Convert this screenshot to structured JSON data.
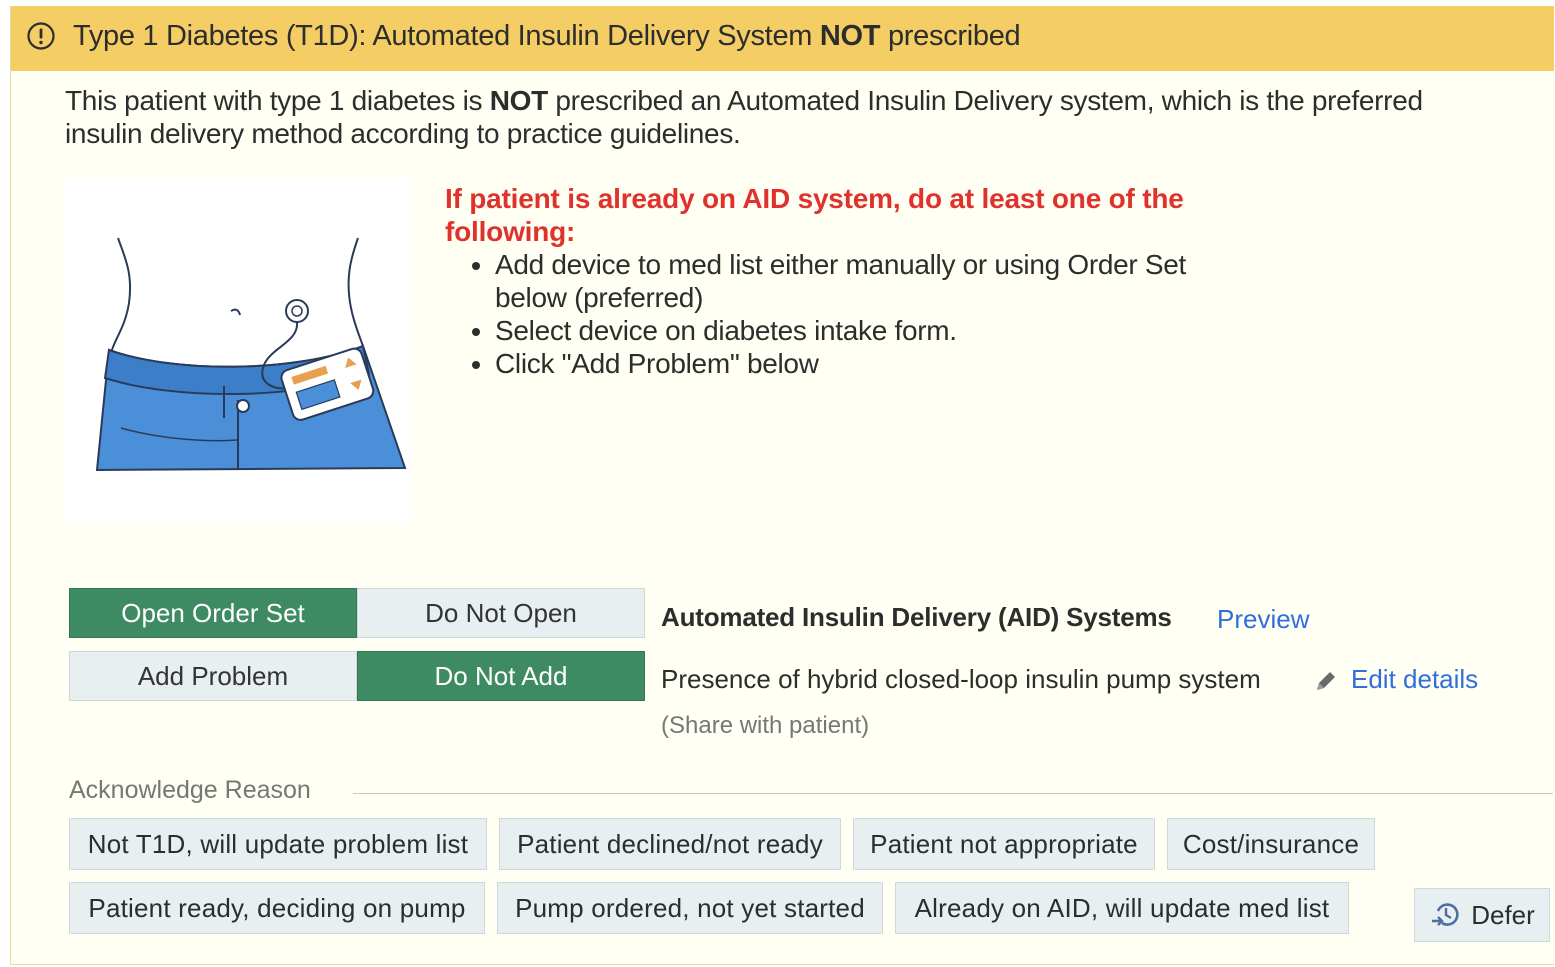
{
  "header": {
    "title_pre": "Type 1 Diabetes (T1D): Automated Insulin Delivery System ",
    "title_bold": "NOT",
    "title_post": " prescribed"
  },
  "description": {
    "pre": "This patient with type 1 diabetes is ",
    "bold": "NOT",
    "post": " prescribed an Automated Insulin Delivery system, which is the preferred insulin delivery method according to practice guidelines."
  },
  "instructions": {
    "heading": "If patient is already on AID system, do at least one of the following:",
    "items": [
      "Add device to med list either manually or using Order Set below (preferred)",
      "Select device on diabetes intake form.",
      "Click \"Add Problem\" below"
    ]
  },
  "order_set": {
    "open_label": "Open Order Set",
    "do_not_open_label": "Do Not Open",
    "title": "Automated Insulin Delivery (AID) Systems",
    "preview_label": "Preview"
  },
  "problem": {
    "add_label": "Add Problem",
    "do_not_add_label": "Do Not Add",
    "text": "Presence of hybrid closed-loop insulin pump system",
    "edit_label": "Edit details",
    "share_label": "(Share with patient)"
  },
  "acknowledge": {
    "label": "Acknowledge Reason",
    "reasons": [
      "Not T1D, will update problem list",
      "Patient declined/not ready",
      "Patient not appropriate",
      "Cost/insurance",
      "Patient ready, deciding on pump",
      "Pump ordered, not yet started",
      "Already on AID, will update med list"
    ],
    "defer_label": "Defer"
  },
  "colors": {
    "header_bg": "#f4cd65",
    "panel_bg": "#fffff3",
    "active_button": "#3e8b63",
    "inactive_button": "#e8eff1",
    "link": "#2f6fdc",
    "warning_text": "#e0322d"
  }
}
